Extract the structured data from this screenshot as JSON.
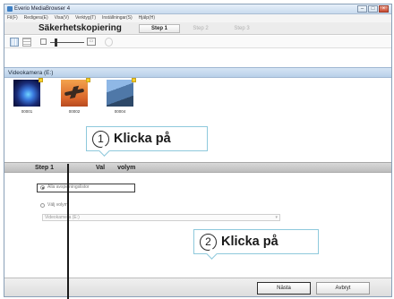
{
  "window": {
    "title": "Everio MediaBrowser 4",
    "controls": {
      "minimize": "–",
      "maximize": "□",
      "close": "×"
    }
  },
  "menu": {
    "items": [
      "Fil(F)",
      "Redigera(E)",
      "Visa(V)",
      "Verktyg(T)",
      "Inställningar(S)",
      "Hjälp(H)"
    ]
  },
  "steps_bar": {
    "mode_title": "Säkerhetskopiering",
    "steps": [
      {
        "label": "Step 1",
        "active": true
      },
      {
        "label": "Step 2",
        "active": false
      },
      {
        "label": "Step 3",
        "active": false
      }
    ]
  },
  "toolbar": {
    "zoom_large_label": "▭"
  },
  "device": {
    "label": "Videokamera (E:)"
  },
  "thumbnails": [
    {
      "name": "00001",
      "icon": "fireworks-thumbnail"
    },
    {
      "name": "00002",
      "icon": "airplane-thumbnail"
    },
    {
      "name": "00004",
      "icon": "building-thumbnail"
    }
  ],
  "step_panel": {
    "step": "Step 1",
    "title_prefix": "Val",
    "title_suffix": "volym",
    "option_all": "Alla avspelningslistor",
    "option_volume": "Välj volym",
    "select_value": "Videokamera (E:)",
    "select_caret": "▾"
  },
  "buttons": {
    "next": "Nästa",
    "cancel": "Avbryt"
  },
  "callouts": [
    {
      "number": "1",
      "text": "Klicka på"
    },
    {
      "number": "2",
      "text": "Klicka på"
    }
  ],
  "colors": {
    "callout_border": "#8ec9dc",
    "header_blue": "#c9dbee",
    "leader_line": "#1a1a1a"
  }
}
